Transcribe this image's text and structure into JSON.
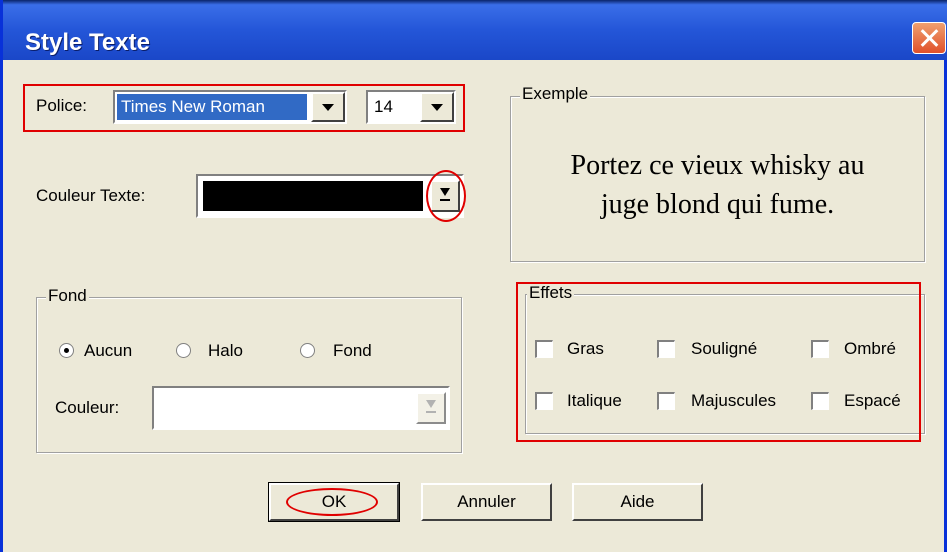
{
  "window": {
    "title": "Style Texte"
  },
  "police": {
    "label": "Police:",
    "font_value": "Times New Roman",
    "size_value": "14"
  },
  "couleur_texte": {
    "label": "Couleur Texte:",
    "color": "#000000"
  },
  "exemple": {
    "title": "Exemple",
    "sample_line1": "Portez ce vieux whisky au",
    "sample_line2": "juge blond qui fume."
  },
  "fond": {
    "title": "Fond",
    "options": [
      "Aucun",
      "Halo",
      "Fond"
    ],
    "selected": "Aucun",
    "couleur_label": "Couleur:"
  },
  "effets": {
    "title": "Effets",
    "items": [
      "Gras",
      "Souligné",
      "Ombré",
      "Italique",
      "Majuscules",
      "Espacé"
    ]
  },
  "buttons": {
    "ok": "OK",
    "annuler": "Annuler",
    "aide": "Aide"
  },
  "colors": {
    "annotation_red": "#e00000",
    "selection_blue": "#316ac5",
    "titlebar_blue": "#2456d8"
  },
  "icons": {
    "close": "close-icon",
    "dropdown": "chevron-down-icon",
    "color_picker": "download-arrow-icon"
  }
}
